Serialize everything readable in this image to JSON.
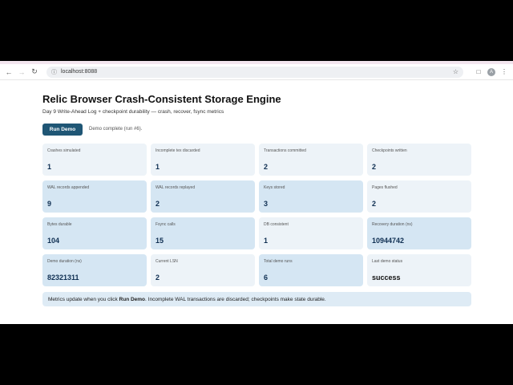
{
  "browser": {
    "url": "localhost:8088",
    "avatar_letter": "A"
  },
  "page": {
    "title": "Relic Browser Crash-Consistent Storage Engine",
    "subtitle": "Day 9 Write-Ahead Log + checkpoint durability — crash, recover, fsync metrics",
    "run_button": "Run Demo",
    "status": "Demo complete (run #6).",
    "footer_prefix": "Metrics update when you click ",
    "footer_bold": "Run Demo",
    "footer_suffix": ". Incomplete WAL transactions are discarded; checkpoints make state durable."
  },
  "metrics": [
    {
      "label": "Crashes simulated",
      "value": "1",
      "tone": "light"
    },
    {
      "label": "Incomplete tex discarded",
      "value": "1",
      "tone": "light"
    },
    {
      "label": "Transactions committed",
      "value": "2",
      "tone": "light"
    },
    {
      "label": "Checkpoints written",
      "value": "2",
      "tone": "light"
    },
    {
      "label": "WAL records appended",
      "value": "9",
      "tone": "mid"
    },
    {
      "label": "WAL records replayed",
      "value": "2",
      "tone": "mid"
    },
    {
      "label": "Keys stored",
      "value": "3",
      "tone": "mid"
    },
    {
      "label": "Pages flushed",
      "value": "2",
      "tone": "light"
    },
    {
      "label": "Bytes durable",
      "value": "104",
      "tone": "mid"
    },
    {
      "label": "Fsync calls",
      "value": "15",
      "tone": "mid"
    },
    {
      "label": "DB consistent",
      "value": "1",
      "tone": "light"
    },
    {
      "label": "Recovery duration (ns)",
      "value": "10944742",
      "tone": "mid"
    },
    {
      "label": "Demo duration (ns)",
      "value": "82321311",
      "tone": "mid"
    },
    {
      "label": "Current LSN",
      "value": "2",
      "tone": "light"
    },
    {
      "label": "Total demo runs",
      "value": "6",
      "tone": "mid"
    },
    {
      "label": "Last demo status",
      "value": "success",
      "tone": "light"
    }
  ],
  "colors": {
    "button": "#1f5675",
    "card_light": "#edf3f8",
    "card_mid": "#d5e6f3",
    "value": "#0f2f52"
  },
  "icons": [
    "back-icon",
    "forward-icon",
    "reload-icon",
    "info-icon",
    "star-icon",
    "extensions-icon",
    "menu-icon"
  ]
}
